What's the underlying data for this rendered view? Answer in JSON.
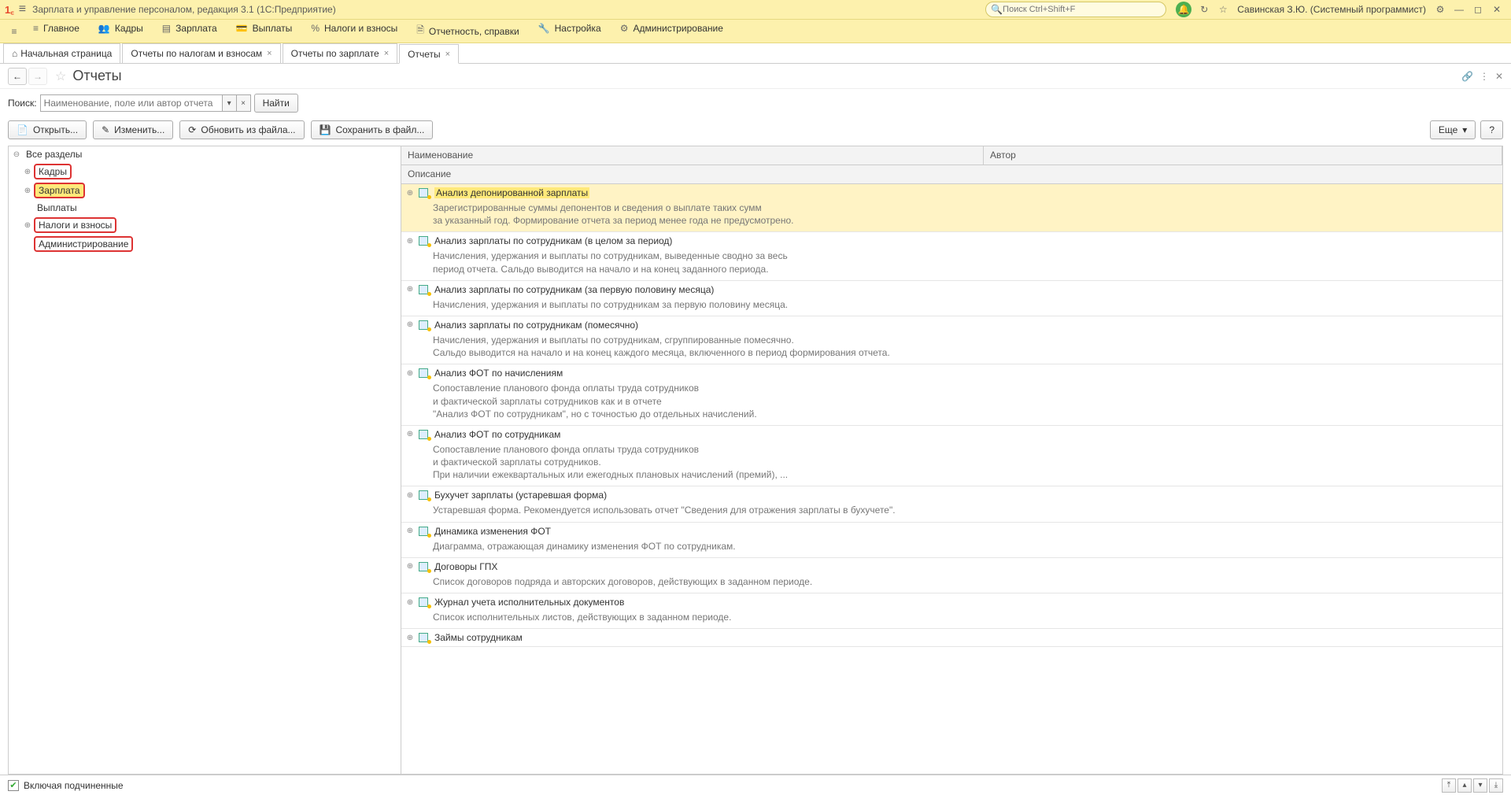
{
  "titlebar": {
    "app_title": "Зарплата и управление персоналом, редакция 3.1  (1С:Предприятие)",
    "search_placeholder": "Поиск Ctrl+Shift+F",
    "user": "Савинская З.Ю. (Системный программист)"
  },
  "menu": {
    "items": [
      {
        "icon": "≡",
        "label": "Главное"
      },
      {
        "icon": "👥",
        "label": "Кадры"
      },
      {
        "icon": "▤",
        "label": "Зарплата"
      },
      {
        "icon": "💳",
        "label": "Выплаты"
      },
      {
        "icon": "%",
        "label": "Налоги и взносы"
      },
      {
        "icon": "🗎",
        "label": "Отчетность, справки"
      },
      {
        "icon": "🔧",
        "label": "Настройка"
      },
      {
        "icon": "⚙",
        "label": "Администрирование"
      }
    ]
  },
  "tabs": [
    {
      "label": "Начальная страница",
      "home": true,
      "closable": false
    },
    {
      "label": "Отчеты по налогам и взносам",
      "closable": true
    },
    {
      "label": "Отчеты по зарплате",
      "closable": true
    },
    {
      "label": "Отчеты",
      "closable": true,
      "active": true
    }
  ],
  "page": {
    "title": "Отчеты",
    "search_label": "Поиск:",
    "search_placeholder": "Наименование, поле или автор отчета",
    "find_btn": "Найти"
  },
  "toolbar": {
    "open": "Открыть...",
    "edit": "Изменить...",
    "reload": "Обновить из файла...",
    "save": "Сохранить в файл...",
    "more": "Еще"
  },
  "tree": {
    "root": "Все разделы",
    "items": [
      {
        "label": "Кадры",
        "expandable": true,
        "red": true
      },
      {
        "label": "Зарплата",
        "expandable": true,
        "red": true,
        "hilite": true
      },
      {
        "label": "Выплаты",
        "expandable": false,
        "red": false
      },
      {
        "label": "Налоги и взносы",
        "expandable": true,
        "red": true
      },
      {
        "label": "Администрирование",
        "expandable": false,
        "red": true
      }
    ]
  },
  "columns": {
    "name": "Наименование",
    "author": "Автор",
    "desc": "Описание"
  },
  "reports": [
    {
      "title": "Анализ депонированной зарплаты",
      "sel": true,
      "desc": "Зарегистрированные суммы депонентов и сведения о выплате таких сумм\nза указанный год. Формирование отчета за период менее года не предусмотрено."
    },
    {
      "title": "Анализ зарплаты по сотрудникам (в целом за период)",
      "desc": "Начисления, удержания и выплаты по сотрудникам, выведенные сводно за весь\nпериод отчета. Сальдо выводится на начало и на конец заданного периода."
    },
    {
      "title": "Анализ зарплаты по сотрудникам (за первую половину месяца)",
      "desc": "Начисления, удержания и выплаты по сотрудникам за первую половину месяца."
    },
    {
      "title": "Анализ зарплаты по сотрудникам (помесячно)",
      "desc": "Начисления, удержания и выплаты по сотрудникам, сгруппированные помесячно.\nСальдо выводится на начало и на конец каждого месяца, включенного в период формирования отчета."
    },
    {
      "title": "Анализ ФОТ по начислениям",
      "desc": "Сопоставление планового фонда оплаты труда сотрудников\nи фактической зарплаты сотрудников как и в отчете\n\"Анализ ФОТ по сотрудникам\", но с точностью до отдельных начислений."
    },
    {
      "title": "Анализ ФОТ по сотрудникам",
      "desc": "Сопоставление планового фонда оплаты труда сотрудников\nи фактической зарплаты сотрудников.\nПри наличии ежеквартальных или ежегодных плановых начислений (премий), ..."
    },
    {
      "title": "Бухучет зарплаты (устаревшая форма)",
      "desc": "Устаревшая форма. Рекомендуется использовать отчет \"Сведения для отражения зарплаты в бухучете\"."
    },
    {
      "title": "Динамика изменения ФОТ",
      "desc": "Диаграмма, отражающая динамику изменения ФОТ по сотрудникам."
    },
    {
      "title": "Договоры ГПХ",
      "desc": "Список договоров подряда и авторских договоров, действующих в заданном периоде."
    },
    {
      "title": "Журнал учета исполнительных документов",
      "desc": "Список исполнительных листов, действующих в заданном периоде."
    },
    {
      "title": "Займы сотрудникам",
      "desc": ""
    }
  ],
  "footer": {
    "check_label": "Включая подчиненные"
  }
}
